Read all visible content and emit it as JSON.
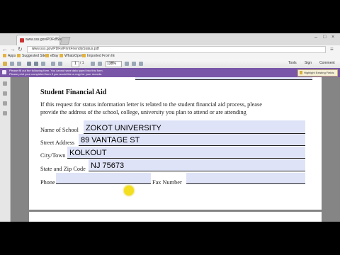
{
  "browser": {
    "tab_title": "www.sss.gov/PDFs/Status...",
    "url": "www.sss.gov/PDFs/PrintFriendlyStatus.pdf",
    "bookmarks": [
      "Apps",
      "Suggested Sites",
      "eBay",
      "WhatsOpen",
      "Imported From IE"
    ]
  },
  "pdf_toolbar": {
    "page_current": "1",
    "page_total": "/ 1",
    "zoom": "138%",
    "tools_label": "Tools",
    "sign_label": "Sign",
    "comment_label": "Comment"
  },
  "notification": {
    "line1": "Please fill out the following form. You cannot save data typed into this form.",
    "line2": "Please print your completed form if you would like a copy for your records.",
    "highlight_label": "Highlight Existing Fields"
  },
  "document": {
    "heading": "Student Financial Aid",
    "intro_line1": "If this request for status information letter is related to the student financial aid process, please",
    "intro_line2": "provide the address of the school, college, university you plan to attend or are attending",
    "fields": {
      "school_name": {
        "label": "Name of School",
        "value": "ZOKOT UNIVERSITY"
      },
      "street_address": {
        "label": "Street Address",
        "value": "89 VANTAGE ST"
      },
      "city_town": {
        "label": "City/Town",
        "value": "KOLKOUT"
      },
      "state_zip": {
        "label": "State and Zip Code",
        "value": "NJ 75673"
      },
      "phone": {
        "label": "Phone",
        "value": ""
      },
      "fax": {
        "label": "Fax Number",
        "value": ""
      }
    }
  }
}
